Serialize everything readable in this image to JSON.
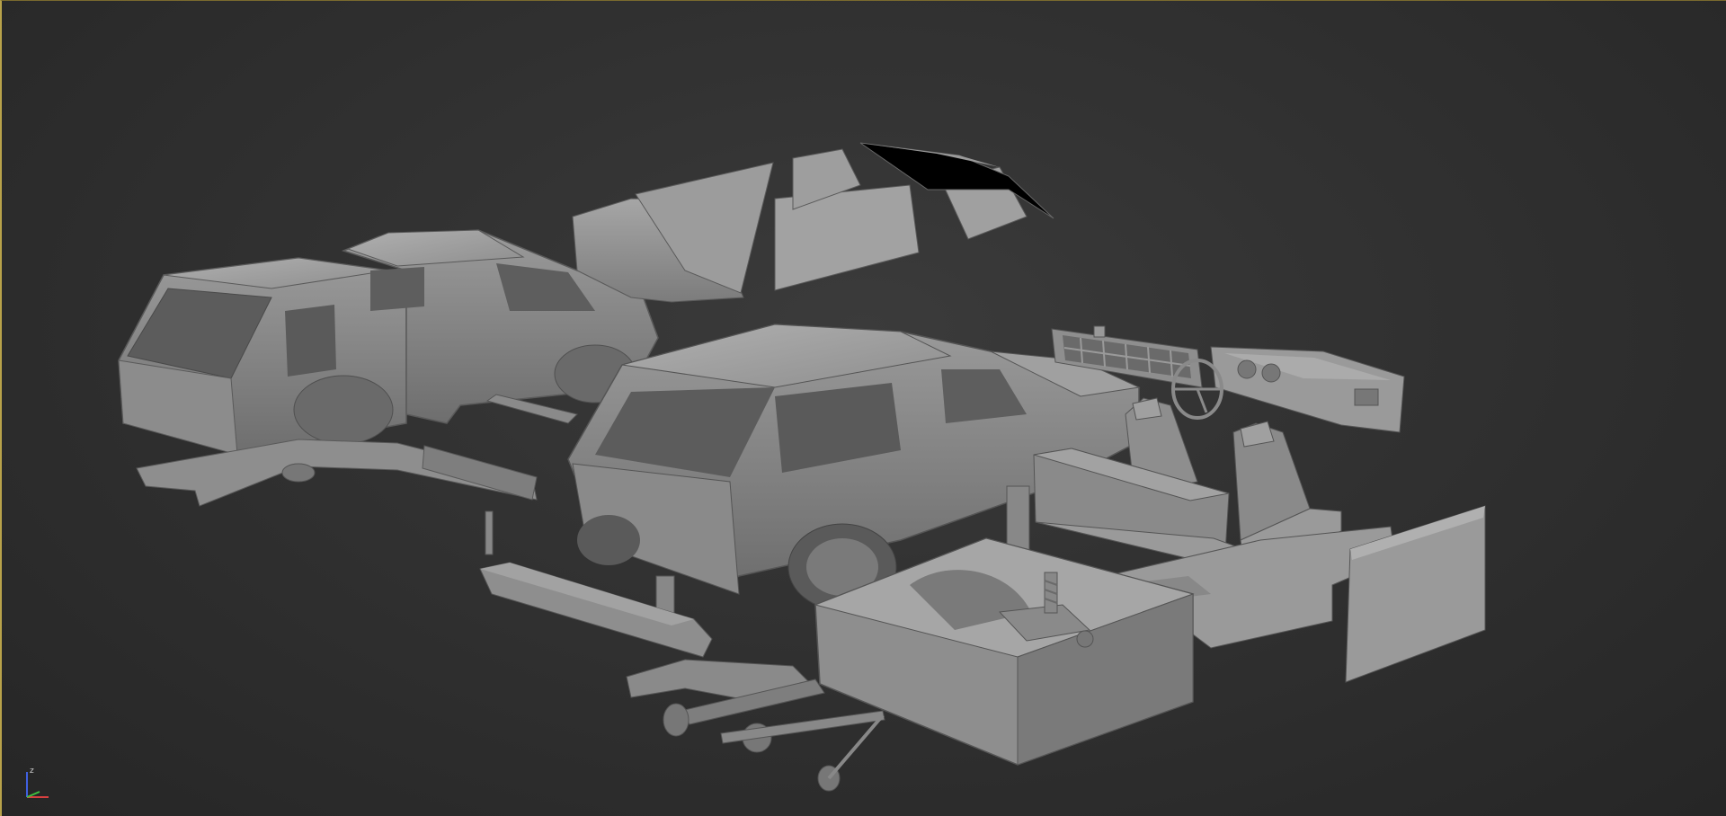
{
  "viewport": {
    "border_color": "#b8a24a",
    "background_color": "#2e2e2e"
  },
  "scene": {
    "model_color": "#8a8a8a",
    "shadow_color": "#555555",
    "highlight_color": "#a8a8a8",
    "glass_color": "#000000",
    "parts": [
      "rear-body-shell",
      "front-body-shell",
      "rear-chassis-frame",
      "door-and-window-panels",
      "assembled-vehicle-body",
      "front-grille",
      "dashboard",
      "steering-wheel",
      "front-seats",
      "rear-bench-seat",
      "floor-pan",
      "rear-panel",
      "rear-bumper",
      "front-chassis-axle",
      "rear-cargo-tub",
      "rear-suspension"
    ]
  },
  "gizmo": {
    "x_color": "#d84040",
    "y_color": "#40c040",
    "z_color": "#4060e0",
    "z_label": "z"
  }
}
